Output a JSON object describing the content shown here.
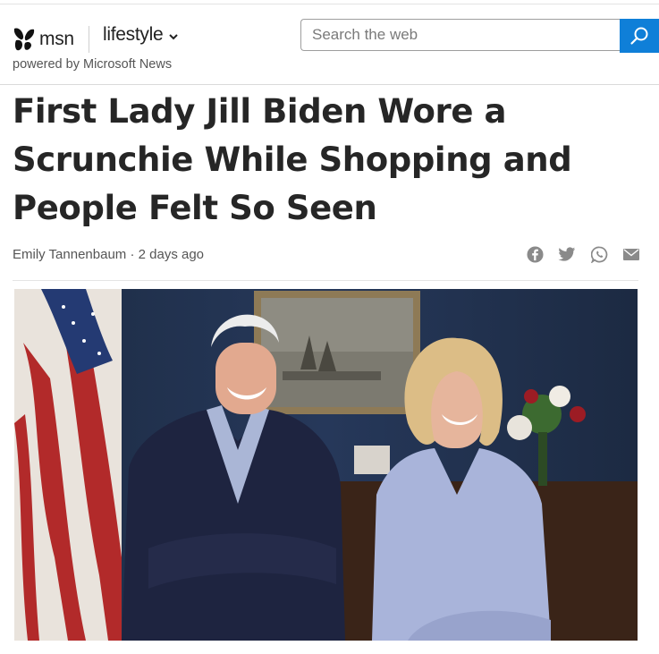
{
  "header": {
    "brand": "msn",
    "section": "lifestyle",
    "powered_by": "powered by Microsoft News",
    "icons": {
      "logo": "butterfly-logo-icon",
      "section_menu": "chevron-down-icon",
      "search": "search-icon"
    }
  },
  "search": {
    "placeholder": "Search the web"
  },
  "article": {
    "title": "First Lady Jill Biden Wore a Scrunchie While Shopping and People Felt So Seen",
    "byline": "Emily Tannenbaum · 2 days ago",
    "share_icons": [
      "facebook-icon",
      "twitter-icon",
      "whatsapp-icon",
      "email-icon"
    ]
  },
  "colors": {
    "search_button": "#0f7fd8",
    "title": "#262626",
    "share_icon": "#8a8a8a"
  }
}
